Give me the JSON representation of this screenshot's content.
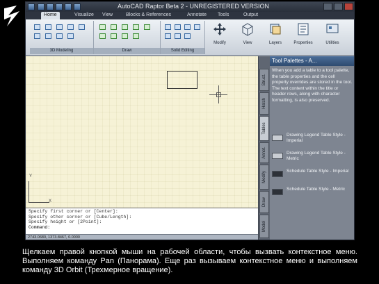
{
  "app": {
    "title": "AutoCAD Raptor Beta 2 - UNREGISTERED VERSION"
  },
  "tabs": [
    "Home",
    "Visualize",
    "View",
    "Blocks & References",
    "Annotate",
    "Tools",
    "Output"
  ],
  "ribbon": {
    "panels": [
      "3D Modeling",
      "Draw",
      "Solid Editing"
    ],
    "big_tools": [
      "Modify",
      "View",
      "Layers",
      "Properties",
      "Utilities"
    ]
  },
  "canvas": {
    "ucs_x": "X",
    "ucs_y": "Y"
  },
  "palette": {
    "title": "Tool Palettes - A...",
    "description": "When you add a table to a tool palette, the table properties and the cell property overrides are stored in the tool. The text content within the title or header rows, along with character formatting, is also preserved.",
    "items": [
      {
        "label": "Drawing Legend Table Style - Imperial"
      },
      {
        "label": "Drawing Legend Table Style - Metric"
      },
      {
        "label": "Schedule Table Style - Imperial"
      },
      {
        "label": "Schedule Table Style - Metric"
      }
    ],
    "vtabs": [
      "Model",
      "Draw",
      "Modify",
      "Annot.",
      "Tables",
      "Hatch",
      "Struct."
    ]
  },
  "command": {
    "lines": [
      "Specify first corner or [Center]:",
      "Specify other corner or [Cube/Length]:",
      "Specify height or [2Point]:"
    ],
    "prompt": "Command:"
  },
  "status": {
    "coords": "2743.0680, 1373.8467, 0.0000"
  },
  "caption": "Щелкаем правой кнопкой мыши на рабочей области, чтобы вызвать контекстное меню. Выполняем команду Pan (Панорама). Еще раз вызываем контекстное меню и выполняем команду 3D Orbit (Трехмерное вращение)."
}
